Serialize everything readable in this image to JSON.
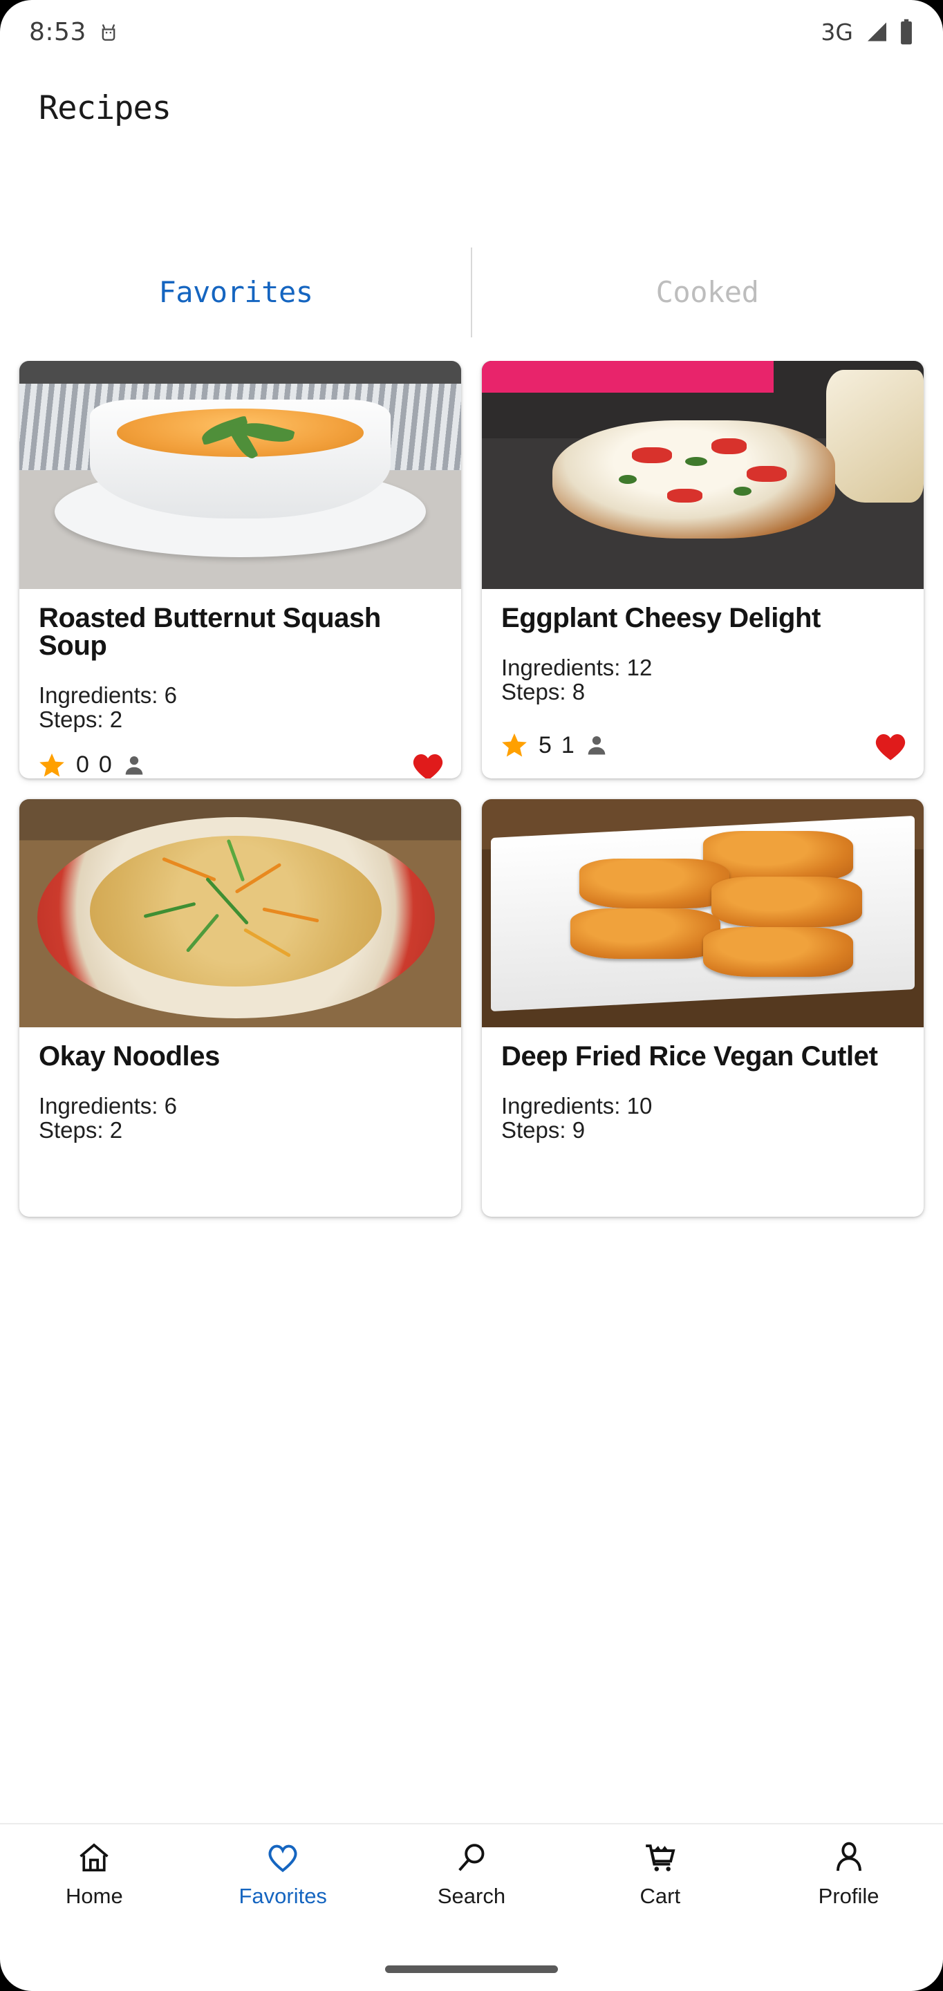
{
  "status_bar": {
    "time": "8:53",
    "network": "3G",
    "icons": [
      "adb-icon",
      "signal-icon",
      "battery-icon"
    ]
  },
  "app_bar": {
    "title": "Recipes"
  },
  "tabs": [
    {
      "label": "Favorites",
      "active": true
    },
    {
      "label": "Cooked",
      "active": false
    }
  ],
  "colors": {
    "accent_blue": "#1565c0",
    "inactive_gray": "#bdbdbd",
    "star_amber": "#FFA000",
    "heart_red": "#E01B1B",
    "person_gray": "#616161"
  },
  "recipes": [
    {
      "title": "Roasted Butternut Squash Soup",
      "ingredients_label": "Ingredients: 6",
      "steps_label": "Steps: 2",
      "rating": "0",
      "raters": "0",
      "favorited": true,
      "photo": "butternut-squash-soup"
    },
    {
      "title": "Eggplant Cheesy Delight",
      "ingredients_label": "Ingredients: 12",
      "steps_label": "Steps: 8",
      "rating": "5",
      "raters": "1",
      "favorited": true,
      "photo": "eggplant-cheesy-delight"
    },
    {
      "title": "Okay Noodles",
      "ingredients_label": "Ingredients: 6",
      "steps_label": "Steps: 2",
      "rating": "",
      "raters": "",
      "favorited": true,
      "photo": "okay-noodles"
    },
    {
      "title": "Deep Fried Rice Vegan Cutlet",
      "ingredients_label": "Ingredients: 10",
      "steps_label": "Steps: 9",
      "rating": "",
      "raters": "",
      "favorited": true,
      "photo": "deep-fried-rice-vegan-cutlet"
    }
  ],
  "bottom_nav": [
    {
      "label": "Home",
      "icon": "home-icon",
      "active": false
    },
    {
      "label": "Favorites",
      "icon": "heart-outline-icon",
      "active": true
    },
    {
      "label": "Search",
      "icon": "search-icon",
      "active": false
    },
    {
      "label": "Cart",
      "icon": "cart-icon",
      "active": false
    },
    {
      "label": "Profile",
      "icon": "profile-icon",
      "active": false
    }
  ]
}
